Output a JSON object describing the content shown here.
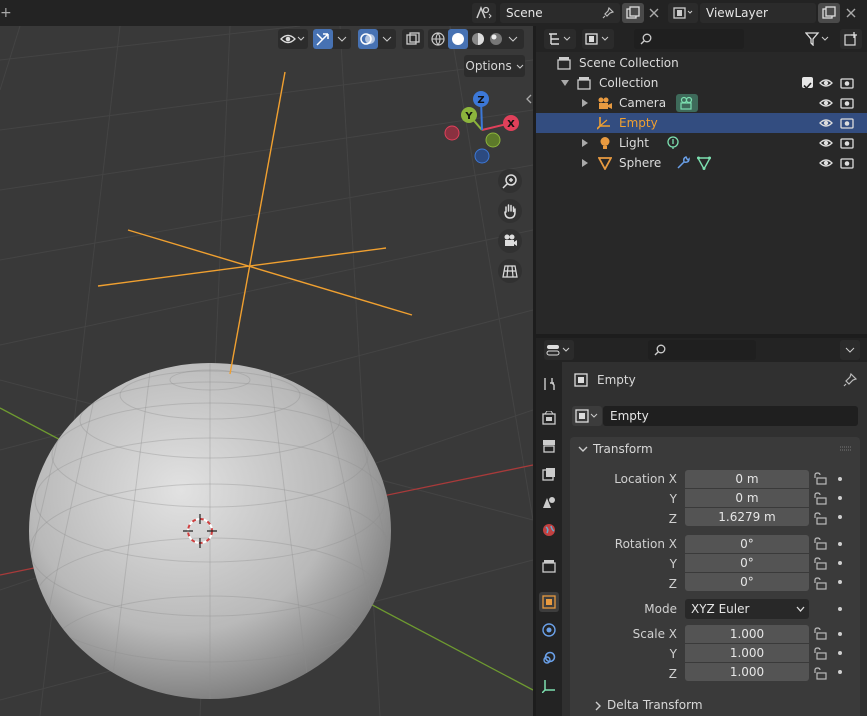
{
  "topbar": {
    "scene_name": "Scene",
    "view_layer_name": "ViewLayer"
  },
  "viewport": {
    "options_label": "Options",
    "gizmo_axes": {
      "x": "X",
      "y": "Y",
      "z": "Z"
    }
  },
  "outliner": {
    "search_placeholder": "",
    "scene_collection": "Scene Collection",
    "collection": "Collection",
    "items": [
      {
        "label": "Camera"
      },
      {
        "label": "Empty"
      },
      {
        "label": "Light"
      },
      {
        "label": "Sphere"
      }
    ]
  },
  "properties": {
    "search_placeholder": "",
    "object_name": "Empty",
    "object_field": "Empty",
    "transform_title": "Transform",
    "location": {
      "label_x": "Location X",
      "label_y": "Y",
      "label_z": "Z",
      "x": "0 m",
      "y": "0 m",
      "z": "1.6279 m"
    },
    "rotation": {
      "label_x": "Rotation X",
      "label_y": "Y",
      "label_z": "Z",
      "x": "0°",
      "y": "0°",
      "z": "0°"
    },
    "mode_label": "Mode",
    "mode_value": "XYZ Euler",
    "scale": {
      "label_x": "Scale X",
      "label_y": "Y",
      "label_z": "Z",
      "x": "1.000",
      "y": "1.000",
      "z": "1.000"
    },
    "delta_transform": "Delta Transform"
  },
  "colors": {
    "selection": "#334d80",
    "empty_orange": "#f0a030",
    "axis_x": "#e0405a",
    "axis_y": "#8cb43c",
    "axis_z": "#3c78d8"
  }
}
